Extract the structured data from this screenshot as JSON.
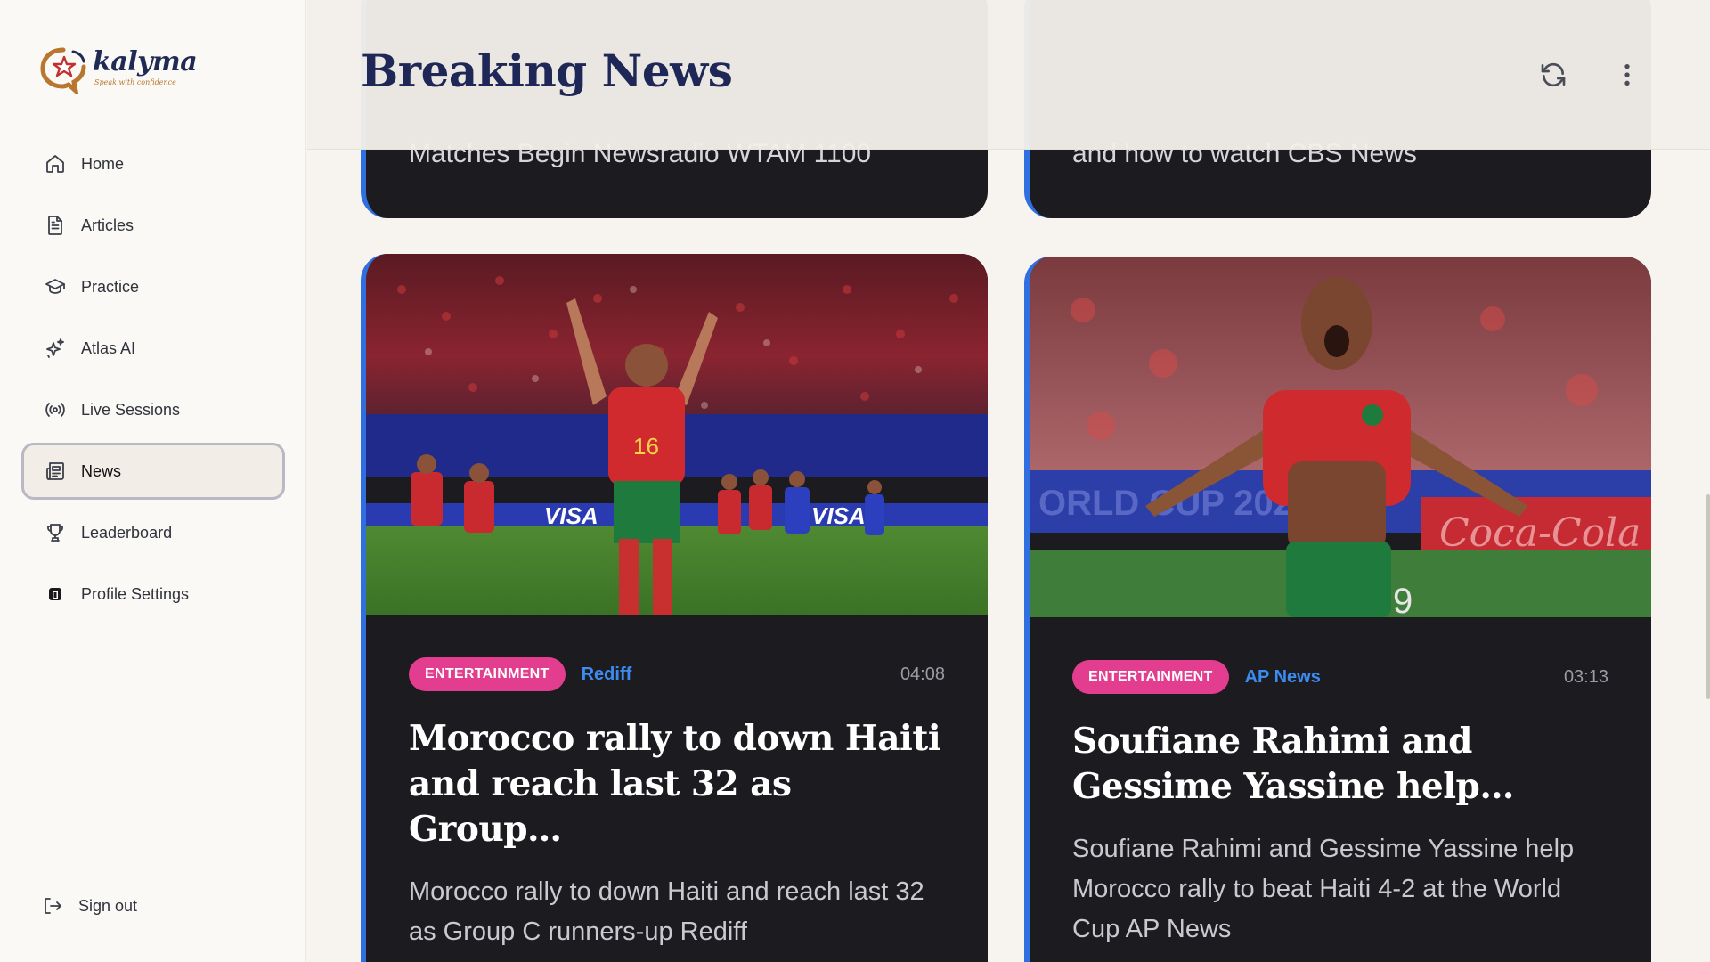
{
  "brand": {
    "name": "kalyma",
    "tagline": "Speak with confidence"
  },
  "sidebar": {
    "items": [
      {
        "label": "Home",
        "icon": "home-icon"
      },
      {
        "label": "Articles",
        "icon": "document-icon"
      },
      {
        "label": "Practice",
        "icon": "graduation-cap-icon"
      },
      {
        "label": "Atlas AI",
        "icon": "sparkles-icon"
      },
      {
        "label": "Live Sessions",
        "icon": "broadcast-icon"
      },
      {
        "label": "News",
        "icon": "newspaper-icon",
        "active": true
      },
      {
        "label": "Leaderboard",
        "icon": "trophy-icon"
      },
      {
        "label": "Profile Settings",
        "icon": "profile-icon"
      }
    ],
    "signout": "Sign out"
  },
  "header": {
    "title": "Breaking News",
    "refresh_icon": "refresh-icon",
    "menu_icon": "more-vertical-icon"
  },
  "articles_top": [
    {
      "snippet": "Matches Begin Newsradio WTAM 1100"
    },
    {
      "snippet": "and how to watch CBS News"
    }
  ],
  "articles": [
    {
      "category": "ENTERTAINMENT",
      "source": "Rediff",
      "time": "04:08",
      "title": "Morocco rally to down Haiti and reach last 32 as Group…",
      "description": "Morocco rally to down Haiti and reach last 32 as Group C runners-up Rediff"
    },
    {
      "category": "ENTERTAINMENT",
      "source": "AP News",
      "time": "03:13",
      "title": "Soufiane Rahimi and Gessime Yassine help…",
      "description": "Soufiane Rahimi and Gessime Yassine help Morocco rally to beat Haiti 4-2 at the World Cup AP News"
    }
  ],
  "colors": {
    "accent": "#2f6fe0",
    "badge": "#e23d8f",
    "source": "#3b8bf0",
    "title": "#1e2756",
    "card": "#1c1b1f"
  }
}
